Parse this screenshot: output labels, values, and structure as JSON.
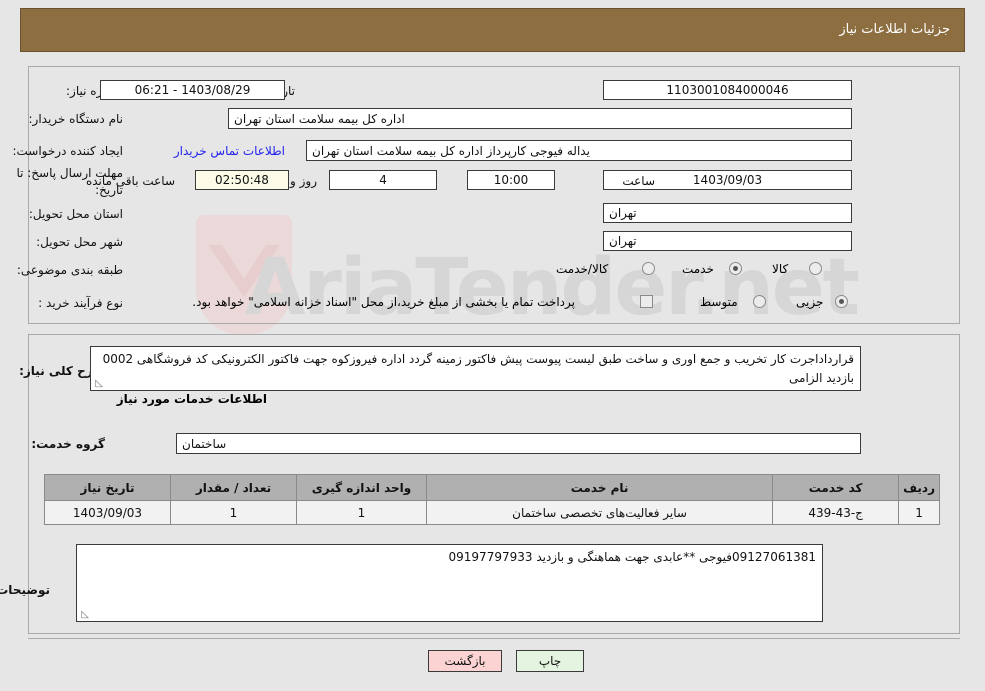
{
  "header": {
    "title": "جزئیات اطلاعات نیاز"
  },
  "form": {
    "need_number_label": "شماره نیاز:",
    "need_number_value": "1103001084000046",
    "announce_label": "تاریخ و ساعت اعلان عمومی:",
    "announce_value": "1403/08/29 - 06:21",
    "buyer_org_label": "نام دستگاه خریدار:",
    "buyer_org_value": "اداره کل بیمه سلامت استان تهران",
    "requester_label": "ایجاد کننده درخواست:",
    "requester_value": "یداله فیوجی کارپرداز اداره کل بیمه سلامت استان تهران",
    "contact_link": "اطلاعات تماس خریدار",
    "deadline_label_line1": "مهلت ارسال پاسخ: تا",
    "deadline_label_line2": "تاریخ:",
    "deadline_date": "1403/09/03",
    "hour_label": "ساعت",
    "hour_value": "10:00",
    "days_value": "4",
    "days_unit": "روز و",
    "countdown_value": "02:50:48",
    "countdown_unit": "ساعت باقی مانده",
    "province_label": "استان محل تحویل:",
    "province_value": "تهران",
    "city_label": "شهر محل تحویل:",
    "city_value": "تهران",
    "category_label": "طبقه بندی موضوعی:",
    "category_options": [
      {
        "label": "کالا",
        "selected": false
      },
      {
        "label": "خدمت",
        "selected": true
      },
      {
        "label": "کالا/خدمت",
        "selected": false
      }
    ],
    "purchase_label": "نوع فرآیند خرید :",
    "purchase_options": [
      {
        "label": "جزیی",
        "selected": true
      },
      {
        "label": "متوسط",
        "selected": false
      }
    ],
    "treasury_checkbox_checked": false,
    "treasury_text": "پرداخت تمام یا بخشی از مبلغ خرید،از محل \"اسناد خزانه اسلامی\" خواهد بود."
  },
  "description": {
    "label": "شرح کلی نیاز:",
    "value": "قرارداداجرت کار تخریب و جمع اوری و ساخت طبق لیست پیوست پیش فاکتور زمینه گردد اداره فیروزکوه  جهت فاکتور الکترونیکی کد فروشگاهی 0002 بازدید الزامی"
  },
  "services": {
    "heading": "اطلاعات خدمات مورد نیاز",
    "group_label": "گروه خدمت:",
    "group_value": "ساختمان",
    "columns": [
      "ردیف",
      "کد خدمت",
      "نام خدمت",
      "واحد اندازه گیری",
      "تعداد / مقدار",
      "تاریخ نیاز"
    ],
    "rows": [
      {
        "row": "1",
        "code": "ج-43-439",
        "name": "سایر فعالیت‌های تخصصی ساختمان",
        "unit": "1",
        "qty": "1",
        "date": "1403/09/03"
      }
    ]
  },
  "buyer_notes": {
    "label": "توضیحات خریدار:",
    "value": "09127061381فیوجی **عابدی جهت هماهنگی و بازدید 09197797933"
  },
  "buttons": {
    "back": "بازگشت",
    "print": "چاپ"
  },
  "watermark": {
    "text": "AriaTender.net"
  },
  "colors": {
    "header_bar": "#8d6e41",
    "page_bg": "#e6e6e6",
    "link": "#2222ee",
    "timer_bg": "#fbfbe8",
    "table_header_bg": "#b0b0b0",
    "back_button_bg": "#fbd3d3",
    "print_button_bg": "#e4f4e0"
  }
}
